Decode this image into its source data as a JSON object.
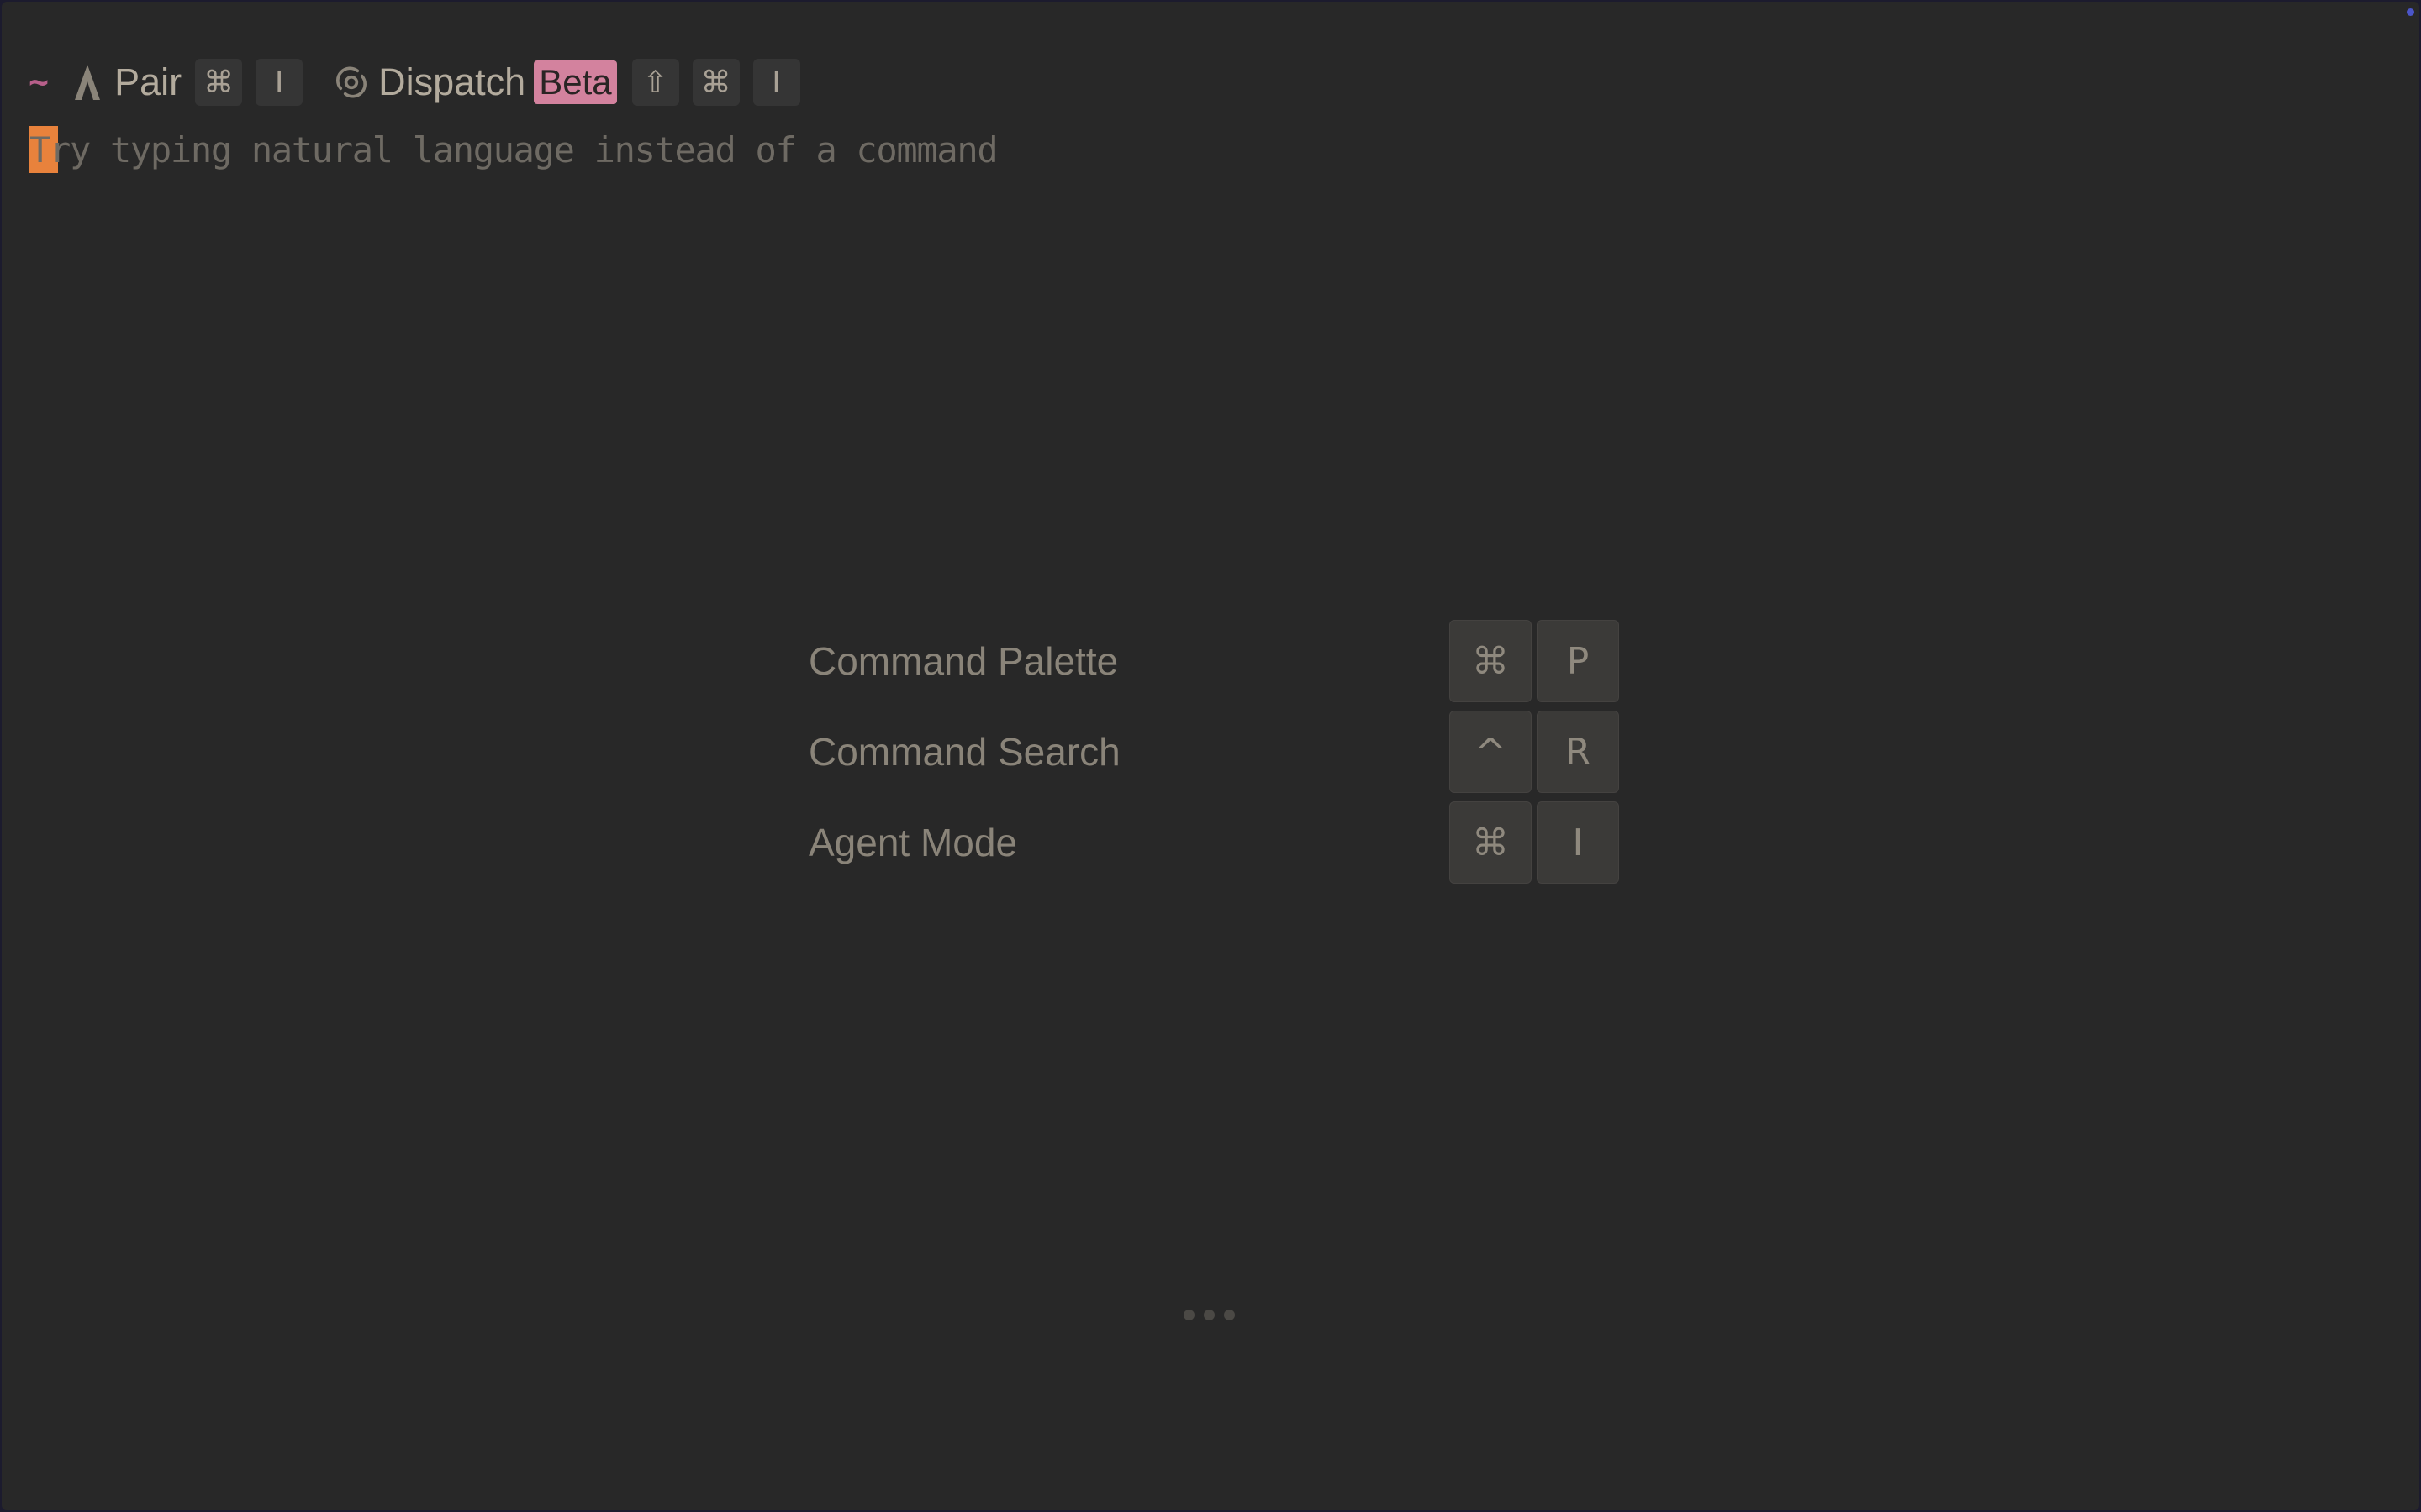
{
  "prompt": {
    "directory_symbol": "~",
    "pair_label": "Pair",
    "pair_shortcut": [
      "⌘",
      "I"
    ],
    "dispatch_label": "Dispatch",
    "dispatch_badge": "Beta",
    "dispatch_shortcut": [
      "⇧",
      "⌘",
      "I"
    ]
  },
  "input": {
    "placeholder": "Try typing natural language instead of a command"
  },
  "hints": [
    {
      "label": "Command Palette",
      "keys": [
        "⌘",
        "P"
      ]
    },
    {
      "label": "Command Search",
      "keys": [
        "^",
        "R"
      ]
    },
    {
      "label": "Agent Mode",
      "keys": [
        "⌘",
        "I"
      ]
    }
  ],
  "icons": {
    "pair": "pair-icon",
    "dispatch": "dispatch-icon"
  },
  "colors": {
    "background": "#282828",
    "cursor": "#e8823c",
    "beta_badge": "#d3829e",
    "tilde": "#b75f8a"
  }
}
